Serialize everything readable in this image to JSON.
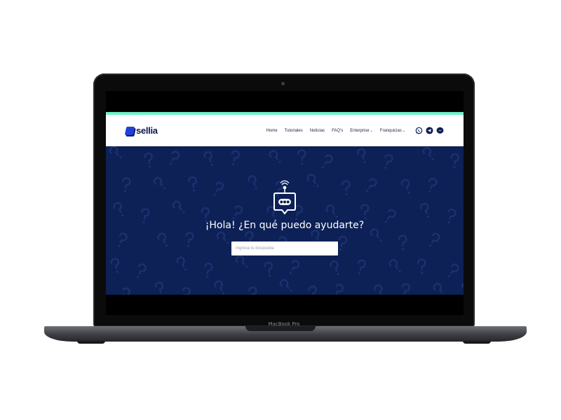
{
  "device": {
    "model_label": "MacBook Pro"
  },
  "site": {
    "logo_text": "sellia",
    "nav": {
      "items": [
        {
          "label": "Home",
          "has_dropdown": false
        },
        {
          "label": "Tutoriales",
          "has_dropdown": false
        },
        {
          "label": "Noticias",
          "has_dropdown": false
        },
        {
          "label": "FAQ's",
          "has_dropdown": false
        },
        {
          "label": "Enterprise",
          "has_dropdown": true
        },
        {
          "label": "Franquicias",
          "has_dropdown": true
        }
      ],
      "social_icons": [
        "whatsapp-icon",
        "telegram-icon",
        "messenger-icon"
      ]
    },
    "hero": {
      "icon": "robot-chat-icon",
      "title": "¡Hola! ¿En qué puedo ayudarte?",
      "search_placeholder": "Ingresa tu búsqueda"
    }
  },
  "colors": {
    "accent_bar": "#6ef0c8",
    "hero_background": "#0d2156",
    "brand_blue": "#2340d6",
    "nav_text": "#1c2445"
  }
}
